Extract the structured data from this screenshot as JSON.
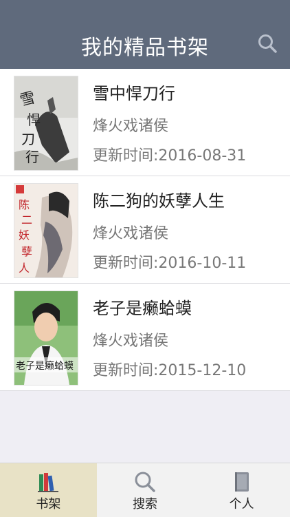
{
  "header": {
    "title": "我的精品书架",
    "search_icon": "search-icon"
  },
  "books": [
    {
      "title": "雪中悍刀行",
      "author": "烽火戏诸侯",
      "updated": "更新时间:2016-08-31",
      "cover_text": "雪中悍刀行"
    },
    {
      "title": "陈二狗的妖孽人生",
      "author": "烽火戏诸侯",
      "updated": "更新时间:2016-10-11",
      "cover_text": "陈二狗的妖孽人生"
    },
    {
      "title": "老子是癞蛤蟆",
      "author": "烽火戏诸侯",
      "updated": "更新时间:2015-12-10",
      "cover_text": "老子是癞蛤蟆"
    }
  ],
  "tabbar": {
    "tabs": [
      {
        "label": "书架",
        "icon": "bookshelf-icon",
        "active": true
      },
      {
        "label": "搜索",
        "icon": "search-icon",
        "active": false
      },
      {
        "label": "个人",
        "icon": "book-icon",
        "active": false
      }
    ]
  },
  "colors": {
    "navbar": "#5f6a7c",
    "active_tab": "#e8e2c6"
  }
}
